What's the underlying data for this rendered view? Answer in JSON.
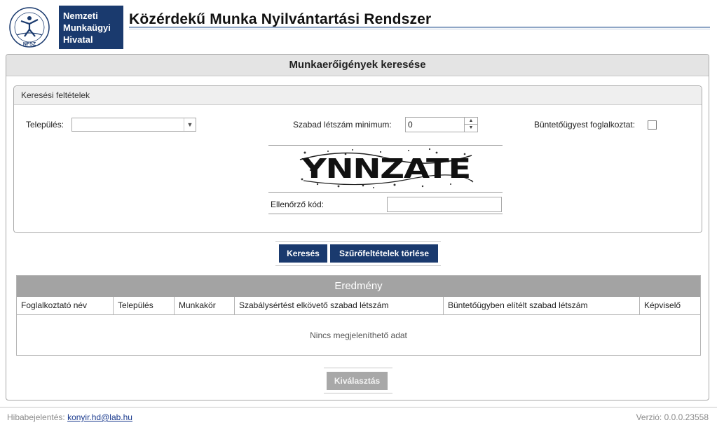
{
  "header": {
    "logo_lines": [
      "Nemzeti",
      "Munkaügyi",
      "Hivatal"
    ],
    "seal_label": "NFSZ",
    "app_title": "Közérdekű Munka Nyilvántartási Rendszer"
  },
  "main": {
    "title": "Munkaerőigények keresése",
    "criteria": {
      "heading": "Keresési feltételek",
      "settlement_label": "Település:",
      "settlement_value": "",
      "free_count_label": "Szabad létszám minimum:",
      "free_count_value": "0",
      "criminal_employer_label": "Büntetőügyest foglalkoztat:",
      "criminal_employer_checked": false,
      "captcha_text": "YNNZATE",
      "verification_label": "Ellenőrző kód:",
      "verification_value": ""
    },
    "buttons": {
      "search": "Keresés",
      "clear_filters": "Szűrőfeltételek törlése",
      "select": "Kiválasztás"
    },
    "results": {
      "heading": "Eredmény",
      "columns": [
        "Foglalkoztató név",
        "Település",
        "Munkakör",
        "Szabálysértést elkövető szabad létszám",
        "Büntetőügyben elítélt szabad létszám",
        "Képviselő"
      ],
      "empty_message": "Nincs megjeleníthető adat"
    }
  },
  "footer": {
    "bug_report_label": "Hibabejelentés:",
    "bug_report_email": "konyir.hd@lab.hu",
    "version": "Verzió: 0.0.0.23558"
  },
  "colors": {
    "brand": "#1a3a6e",
    "disabled": "#a8a8a8",
    "results_header": "#a3a3a3"
  }
}
